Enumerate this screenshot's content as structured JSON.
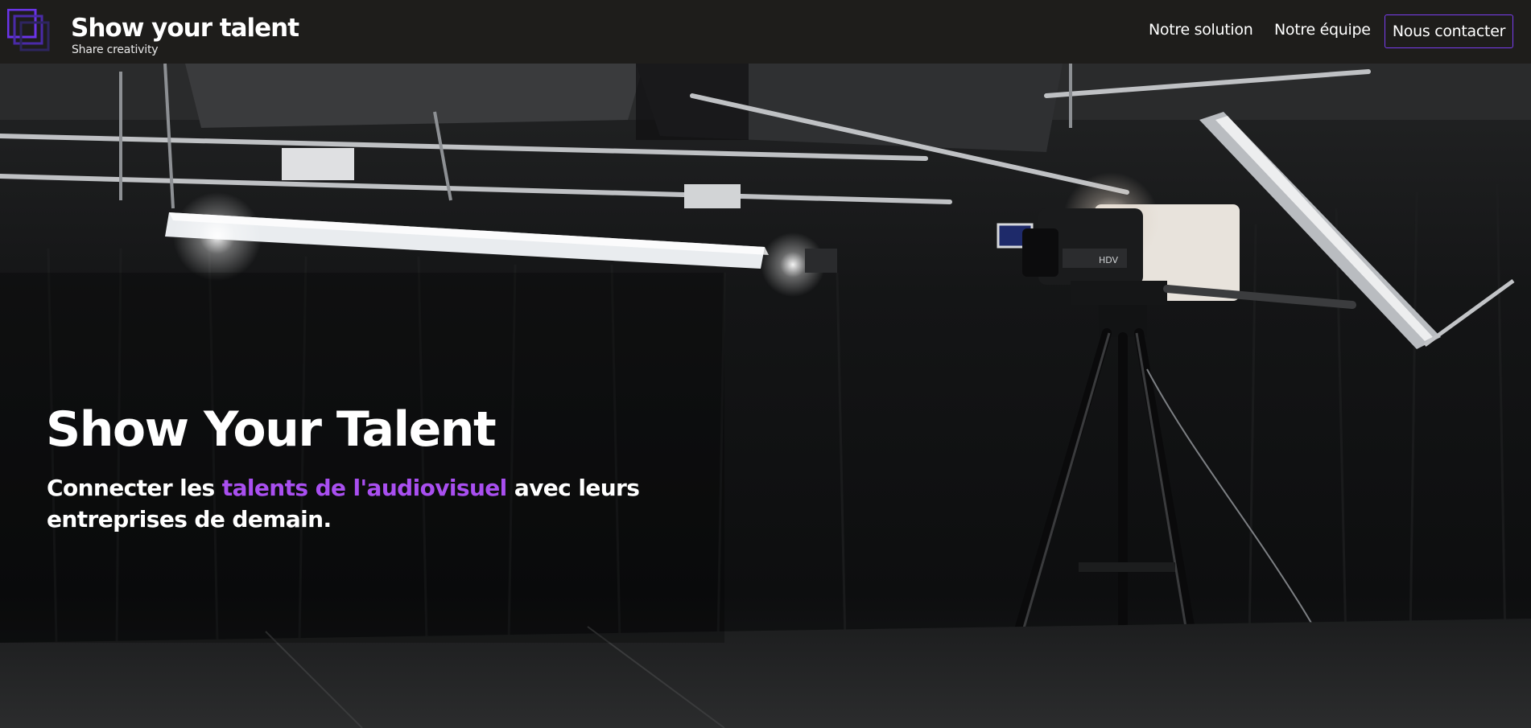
{
  "header": {
    "brand_title": "Show your talent",
    "brand_tagline": "Share creativity",
    "logo_icon": "overlapping-squares-logo",
    "nav": {
      "solution": "Notre solution",
      "team": "Notre équipe",
      "contact": "Nous contacter"
    }
  },
  "hero": {
    "title": "Show Your Talent",
    "subtitle_before": "Connecter les ",
    "subtitle_highlight": "talents de l'audiovisuel",
    "subtitle_after": " avec leurs entreprises de demain.",
    "background": "tv-studio-camera-photo"
  },
  "colors": {
    "header_bg": "#1e1d1b",
    "accent_purple": "#a94ff0",
    "button_border": "#7a3df0",
    "logo_purple": "#5b2ad6"
  }
}
